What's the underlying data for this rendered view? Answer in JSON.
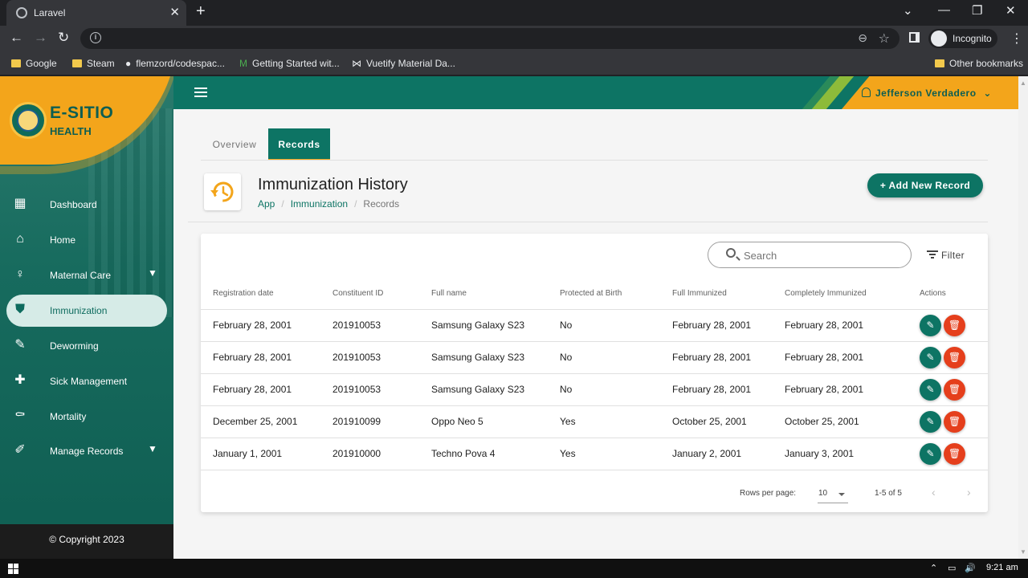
{
  "browser": {
    "tab_title": "Laravel",
    "incognito_label": "Incognito",
    "bookmarks": [
      {
        "label": "Google",
        "icon": "folder-icon"
      },
      {
        "label": "Steam",
        "icon": "folder-icon"
      },
      {
        "label": "flemzord/codespac...",
        "icon": "github-icon"
      },
      {
        "label": "Getting Started wit...",
        "icon": "vuetify-m-icon"
      },
      {
        "label": "Vuetify Material Da...",
        "icon": "bow-icon"
      }
    ],
    "other_bookmarks": "Other bookmarks"
  },
  "brand": {
    "name": "E-SITIO",
    "sub": "HEALTH"
  },
  "sidebar": {
    "items": [
      {
        "label": "Dashboard",
        "icon": "dashboard-icon"
      },
      {
        "label": "Home",
        "icon": "home-icon"
      },
      {
        "label": "Maternal Care",
        "icon": "mother-icon"
      },
      {
        "label": "Immunization",
        "icon": "shield-check-icon"
      },
      {
        "label": "Deworming",
        "icon": "syringe-icon"
      },
      {
        "label": "Sick Management",
        "icon": "medical-bag-icon"
      },
      {
        "label": "Mortality",
        "icon": "grave-icon"
      },
      {
        "label": "Manage Records",
        "icon": "pencil-box-icon"
      }
    ],
    "copyright": "© Copyright 2023"
  },
  "topbar": {
    "user_name": "Jefferson Verdadero"
  },
  "tabs": {
    "overview": "Overview",
    "records": "Records"
  },
  "header": {
    "title": "Immunization History",
    "breadcrumb": [
      "App",
      "Immunization",
      "Records"
    ],
    "add_button": "+ Add New Record"
  },
  "table": {
    "search_placeholder": "Search",
    "filter_label": "Filter",
    "columns": [
      "Registration date",
      "Constituent ID",
      "Full name",
      "Protected at Birth",
      "Full Immunized",
      "Completely Immunized",
      "Actions"
    ],
    "rows": [
      [
        "February 28, 2001",
        "201910053",
        "Samsung Galaxy S23",
        "No",
        "February 28, 2001",
        "February 28, 2001"
      ],
      [
        "February 28, 2001",
        "201910053",
        "Samsung Galaxy S23",
        "No",
        "February 28, 2001",
        "February 28, 2001"
      ],
      [
        "February 28, 2001",
        "201910053",
        "Samsung Galaxy S23",
        "No",
        "February 28, 2001",
        "February 28, 2001"
      ],
      [
        "December 25, 2001",
        "201910099",
        "Oppo Neo 5",
        "Yes",
        "October 25, 2001",
        "October 25, 2001"
      ],
      [
        "January 1, 2001",
        "201910000",
        "Techno Pova 4",
        "Yes",
        "January 2, 2001",
        "January 3, 2001"
      ]
    ],
    "rows_per_page_label": "Rows per page:",
    "rows_per_page_value": "10",
    "range": "1-5 of 5"
  },
  "taskbar": {
    "time": "9:21 am"
  },
  "colors": {
    "primary": "#0d7464",
    "accent": "#f3a51b",
    "danger": "#e53f1c"
  }
}
